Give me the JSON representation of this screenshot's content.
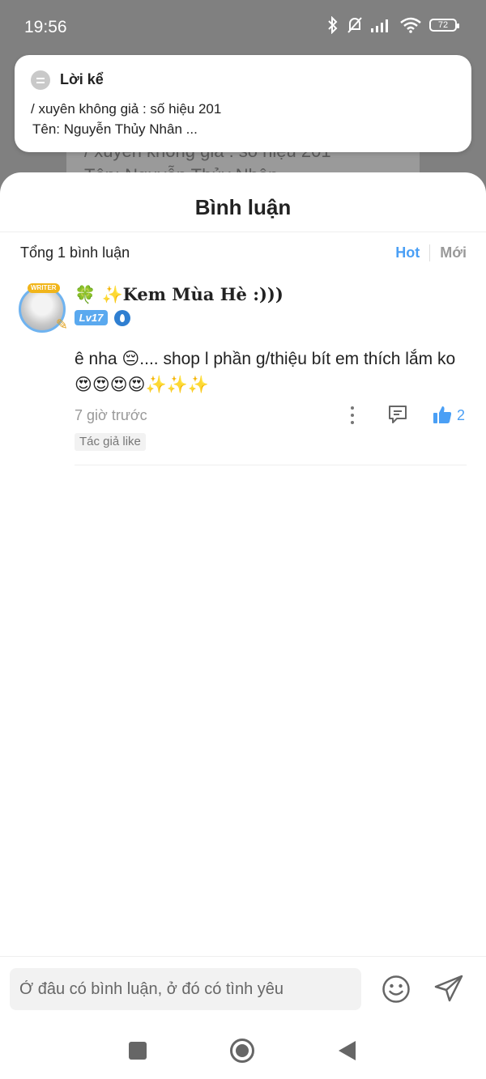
{
  "status_bar": {
    "time": "19:56",
    "battery": "72"
  },
  "background": {
    "line1": "/ xuyên không giả : số hiệu 201",
    "line2": "Tên: Nguyễn Thủy Nhân"
  },
  "notification": {
    "title": "Lời kể",
    "line1": "/ xuyên không giả : số hiệu 201",
    "line2": "Tên: Nguyễn Thủy Nhân ..."
  },
  "comments_sheet": {
    "title": "Bình luận",
    "count_label": "Tổng 1 bình luận",
    "sort_hot": "Hot",
    "sort_new": "Mới",
    "accent_color": "#4a9ff5"
  },
  "comment": {
    "avatar_badge": "WRITER",
    "username": "🍀 ✨Kem Mùa Hè :)))",
    "level": "Lv17",
    "text": "ê nha 😔.... shop l phần g/thiệu bít em thích lắm ko 😍😍😍😍✨✨✨",
    "time": "7 giờ trước",
    "likes": "2",
    "author_tag": "Tác giả like"
  },
  "input_bar": {
    "placeholder": "Ở đâu có bình luận, ở đó có tình yêu"
  }
}
